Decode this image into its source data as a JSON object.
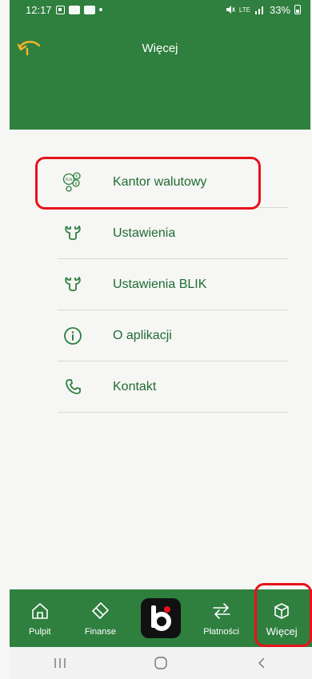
{
  "statusbar": {
    "time": "12:17",
    "network": "LTE",
    "battery": "33%"
  },
  "header": {
    "title": "Więcej"
  },
  "menu": {
    "items": [
      {
        "label": "Kantor walutowy",
        "icon": "currency-exchange-icon"
      },
      {
        "label": "Ustawienia",
        "icon": "wrench-icon"
      },
      {
        "label": "Ustawienia BLIK",
        "icon": "wrench-icon"
      },
      {
        "label": "O aplikacji",
        "icon": "info-icon"
      },
      {
        "label": "Kontakt",
        "icon": "phone-icon"
      }
    ]
  },
  "bottomnav": {
    "items": [
      {
        "label": "Pulpit",
        "icon": "home-icon"
      },
      {
        "label": "Finanse",
        "icon": "card-icon"
      },
      {
        "label": "",
        "icon": "blik-icon"
      },
      {
        "label": "Płatności",
        "icon": "transfer-icon"
      },
      {
        "label": "Więcej",
        "icon": "cube-icon",
        "active": true
      }
    ]
  },
  "colors": {
    "brand_green": "#2f7f3f",
    "label_green": "#1f6b32",
    "highlight_red": "#e8121b",
    "background": "#f6f6f4"
  }
}
